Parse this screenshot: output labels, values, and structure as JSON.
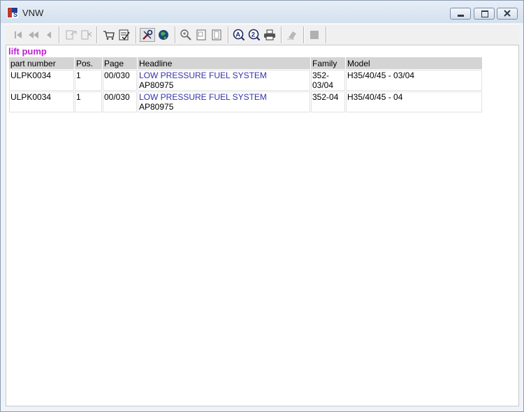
{
  "window": {
    "title": "VNW",
    "minimize_label": "minimize",
    "restore_label": "restore",
    "close_label": "close"
  },
  "toolbar": {
    "buttons": [
      {
        "name": "first-record",
        "icon": "first-icon",
        "enabled": false
      },
      {
        "name": "previous-page",
        "icon": "rewind-icon",
        "enabled": false
      },
      {
        "name": "previous-record",
        "icon": "previous-icon",
        "enabled": false
      },
      {
        "name": "open-document",
        "icon": "document-arrow-icon",
        "enabled": false
      },
      {
        "name": "close-document",
        "icon": "document-close-icon",
        "enabled": false
      },
      {
        "name": "cart",
        "icon": "cart-icon",
        "enabled": true
      },
      {
        "name": "checklist",
        "icon": "checklist-icon",
        "enabled": true
      },
      {
        "name": "tools",
        "icon": "wrench-icon",
        "enabled": true,
        "pressed": true
      },
      {
        "name": "globe",
        "icon": "globe-icon",
        "enabled": true
      },
      {
        "name": "zoom-in",
        "icon": "zoom-in-icon",
        "enabled": true
      },
      {
        "name": "page-view",
        "icon": "page-icon",
        "enabled": true
      },
      {
        "name": "page-fit",
        "icon": "page-fit-icon",
        "enabled": true
      },
      {
        "name": "search-a",
        "icon": "search-a-icon",
        "enabled": true
      },
      {
        "name": "search-2",
        "icon": "search-2-icon",
        "enabled": true
      },
      {
        "name": "print",
        "icon": "printer-icon",
        "enabled": true
      },
      {
        "name": "edit",
        "icon": "eraser-icon",
        "enabled": false
      },
      {
        "name": "stop",
        "icon": "stop-icon",
        "enabled": false
      }
    ]
  },
  "results": {
    "search_term": "lift pump",
    "columns": [
      "part number",
      "Pos.",
      "Page",
      "Headline",
      "Family",
      "Model"
    ],
    "rows": [
      {
        "part_number": "ULPK0034",
        "pos": "1",
        "page": "00/030",
        "headline": "LOW PRESSURE FUEL SYSTEM",
        "headline_ref": "AP80975",
        "family_line1": "352-",
        "family_line2": "03/04",
        "model": "H35/40/45 - 03/04"
      },
      {
        "part_number": "ULPK0034",
        "pos": "1",
        "page": "00/030",
        "headline": "LOW PRESSURE FUEL SYSTEM",
        "headline_ref": "AP80975",
        "family_line1": "352-04",
        "family_line2": "",
        "model": "H35/40/45 - 04"
      }
    ]
  },
  "colors": {
    "search_term": "#c21fd6",
    "headline": "#3333aa",
    "header_bg": "#d4d4d4"
  }
}
